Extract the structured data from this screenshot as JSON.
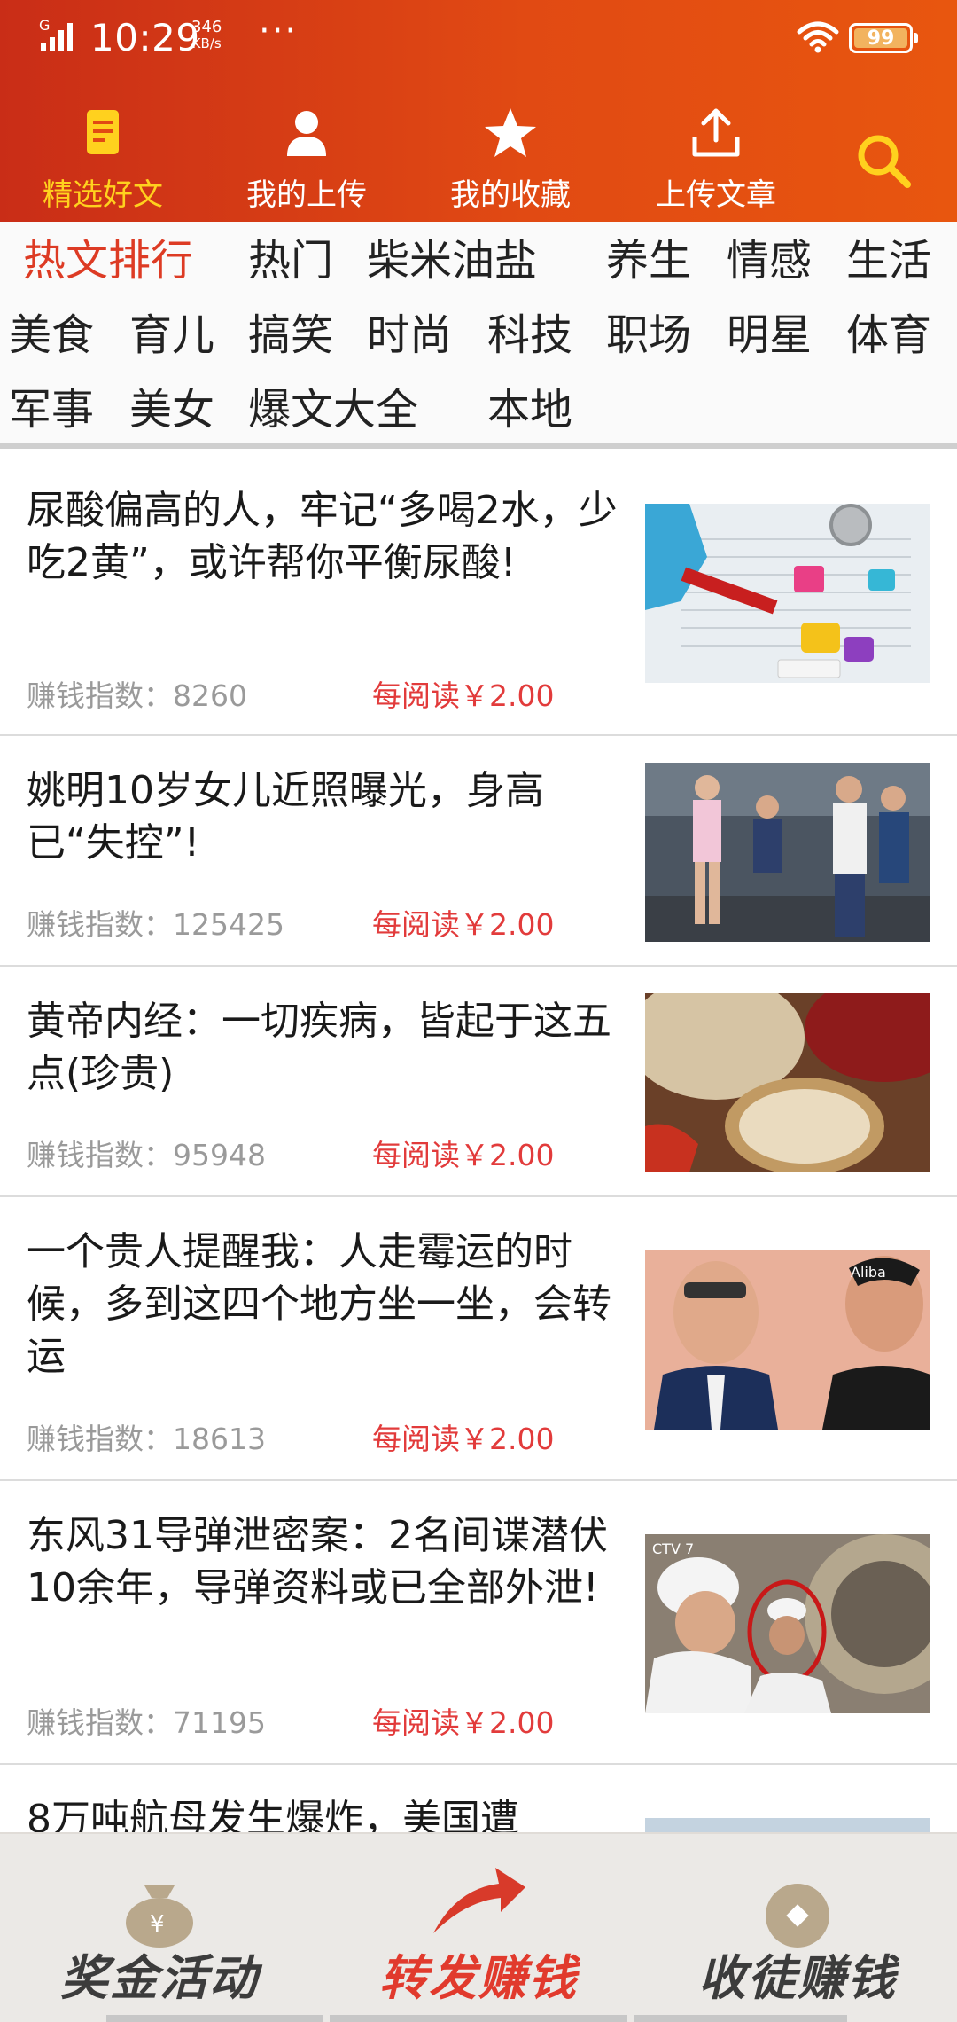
{
  "status_bar": {
    "network_type": "G",
    "time": "10:29",
    "speed_value": "346",
    "speed_unit": "KB/s",
    "more": "···",
    "battery": "99"
  },
  "top_tabs": [
    {
      "label": "精选好文",
      "icon": "document-icon",
      "active": true
    },
    {
      "label": "我的上传",
      "icon": "person-icon",
      "active": false
    },
    {
      "label": "我的收藏",
      "icon": "star-icon",
      "active": false
    },
    {
      "label": "上传文章",
      "icon": "upload-icon",
      "active": false
    }
  ],
  "categories": [
    {
      "label": "热文排行",
      "active": true
    },
    {
      "label": "热门"
    },
    {
      "label": "柴米油盐"
    },
    {
      "label": "养生"
    },
    {
      "label": "情感"
    },
    {
      "label": "生活"
    },
    {
      "label": "美食"
    },
    {
      "label": "育儿"
    },
    {
      "label": "搞笑"
    },
    {
      "label": "时尚"
    },
    {
      "label": "科技"
    },
    {
      "label": "职场"
    },
    {
      "label": "明星"
    },
    {
      "label": "体育"
    },
    {
      "label": "军事"
    },
    {
      "label": "美女"
    },
    {
      "label": "爆文大全"
    },
    {
      "label": "本地"
    }
  ],
  "articles": [
    {
      "title": "尿酸偏高的人，牢记“多喝2水，少吃2黄”，或许帮你平衡尿酸!",
      "index_label": "赚钱指数：",
      "index_value": "8260",
      "reward": "每阅读￥2.00",
      "thumb": "medical-test-image"
    },
    {
      "title": "姚明10岁女儿近照曝光，身高已“失控”!",
      "index_label": "赚钱指数：",
      "index_value": "125425",
      "reward": "每阅读￥2.00",
      "thumb": "girls-photo-image"
    },
    {
      "title": "黄帝内经：一切疾病，皆起于这五点(珍贵)",
      "index_label": "赚钱指数：",
      "index_value": "95948",
      "reward": "每阅读￥2.00",
      "thumb": "grains-image"
    },
    {
      "title": "一个贵人提醒我：人走霉运的时候，多到这四个地方坐一坐，会转运",
      "index_label": "赚钱指数：",
      "index_value": "18613",
      "reward": "每阅读￥2.00",
      "thumb": "businessmen-image"
    },
    {
      "title": "东风31导弹泄密案：2名间谍潜伏10余年，导弹资料或已全部外泄!",
      "index_label": "赚钱指数：",
      "index_value": "71195",
      "reward": "每阅读￥2.00",
      "thumb": "tv-news-image"
    },
    {
      "title": "8万吨航母发生爆炸，美国遭",
      "index_label": "",
      "index_value": "",
      "reward": "",
      "thumb": "sky-image"
    }
  ],
  "bottom_bar": [
    {
      "label": "奖金活动",
      "icon": "money-bag-icon"
    },
    {
      "label": "转发赚钱",
      "icon": "share-arrow-icon"
    },
    {
      "label": "收徒赚钱",
      "icon": "diamond-coin-icon"
    }
  ],
  "colors": {
    "header_start": "#c92d17",
    "header_end": "#e8560f",
    "active_tab": "#ffd11e",
    "active_category": "#dd3b24",
    "reward": "#e23b3b"
  }
}
